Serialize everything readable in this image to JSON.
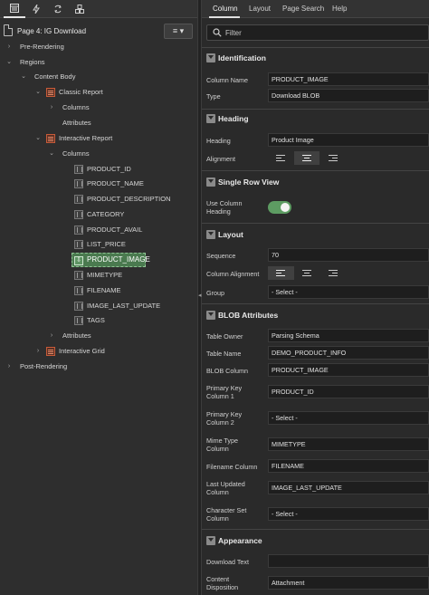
{
  "left_panel": {
    "tabs": [
      {
        "icon": "rendering-icon"
      },
      {
        "icon": "dynamic-actions-icon"
      },
      {
        "icon": "processing-icon"
      },
      {
        "icon": "shared-components-icon"
      }
    ],
    "page_title": "Page 4: IG Download",
    "menu_button_icon": "≡ ▾",
    "tree": {
      "pre_rendering": "Pre-Rendering",
      "regions": "Regions",
      "content_body": "Content Body",
      "classic_report": "Classic Report",
      "cr_columns": "Columns",
      "cr_attributes": "Attributes",
      "interactive_report": "Interactive Report",
      "ir_columns": "Columns",
      "columns": [
        "PRODUCT_ID",
        "PRODUCT_NAME",
        "PRODUCT_DESCRIPTION",
        "CATEGORY",
        "PRODUCT_AVAIL",
        "LIST_PRICE",
        "PRODUCT_IMAGE",
        "MIMETYPE",
        "FILENAME",
        "IMAGE_LAST_UPDATE",
        "TAGS"
      ],
      "ir_attributes": "Attributes",
      "interactive_grid": "Interactive Grid",
      "post_rendering": "Post-Rendering"
    }
  },
  "right_panel": {
    "tabs": [
      "Column",
      "Layout",
      "Page Search",
      "Help"
    ],
    "filter_placeholder": "Filter",
    "groups": {
      "identification": {
        "title": "Identification",
        "column_name_label": "Column Name",
        "column_name_value": "PRODUCT_IMAGE",
        "type_label": "Type",
        "type_value": "Download BLOB"
      },
      "heading": {
        "title": "Heading",
        "heading_label": "Heading",
        "heading_value": "Product Image",
        "alignment_label": "Alignment",
        "alignment_selected": "center"
      },
      "single_row_view": {
        "title": "Single Row View",
        "use_column_heading_label": "Use Column Heading",
        "use_column_heading_value": true
      },
      "layout": {
        "title": "Layout",
        "sequence_label": "Sequence",
        "sequence_value": "70",
        "column_alignment_label": "Column Alignment",
        "column_alignment_selected": "left",
        "group_label": "Group",
        "group_value": "- Select -"
      },
      "blob_attributes": {
        "title": "BLOB Attributes",
        "table_owner_label": "Table Owner",
        "table_owner_value": "Parsing Schema",
        "table_name_label": "Table Name",
        "table_name_value": "DEMO_PRODUCT_INFO",
        "blob_column_label": "BLOB Column",
        "blob_column_value": "PRODUCT_IMAGE",
        "pk1_label": "Primary Key Column 1",
        "pk1_value": "PRODUCT_ID",
        "pk2_label": "Primary Key Column 2",
        "pk2_value": "- Select -",
        "mime_label": "Mime Type Column",
        "mime_value": "MIMETYPE",
        "filename_label": "Filename Column",
        "filename_value": "FILENAME",
        "last_updated_label": "Last Updated Column",
        "last_updated_value": "IMAGE_LAST_UPDATE",
        "charset_label": "Character Set Column",
        "charset_value": "- Select -"
      },
      "appearance": {
        "title": "Appearance",
        "download_text_label": "Download Text",
        "download_text_value": "",
        "content_disposition_label": "Content Disposition",
        "content_disposition_value": "Attachment"
      }
    }
  },
  "colors": {
    "selected_row": "#4a7a4f",
    "toggle_on": "#5d9c62",
    "report_icon": "#c75b39"
  }
}
